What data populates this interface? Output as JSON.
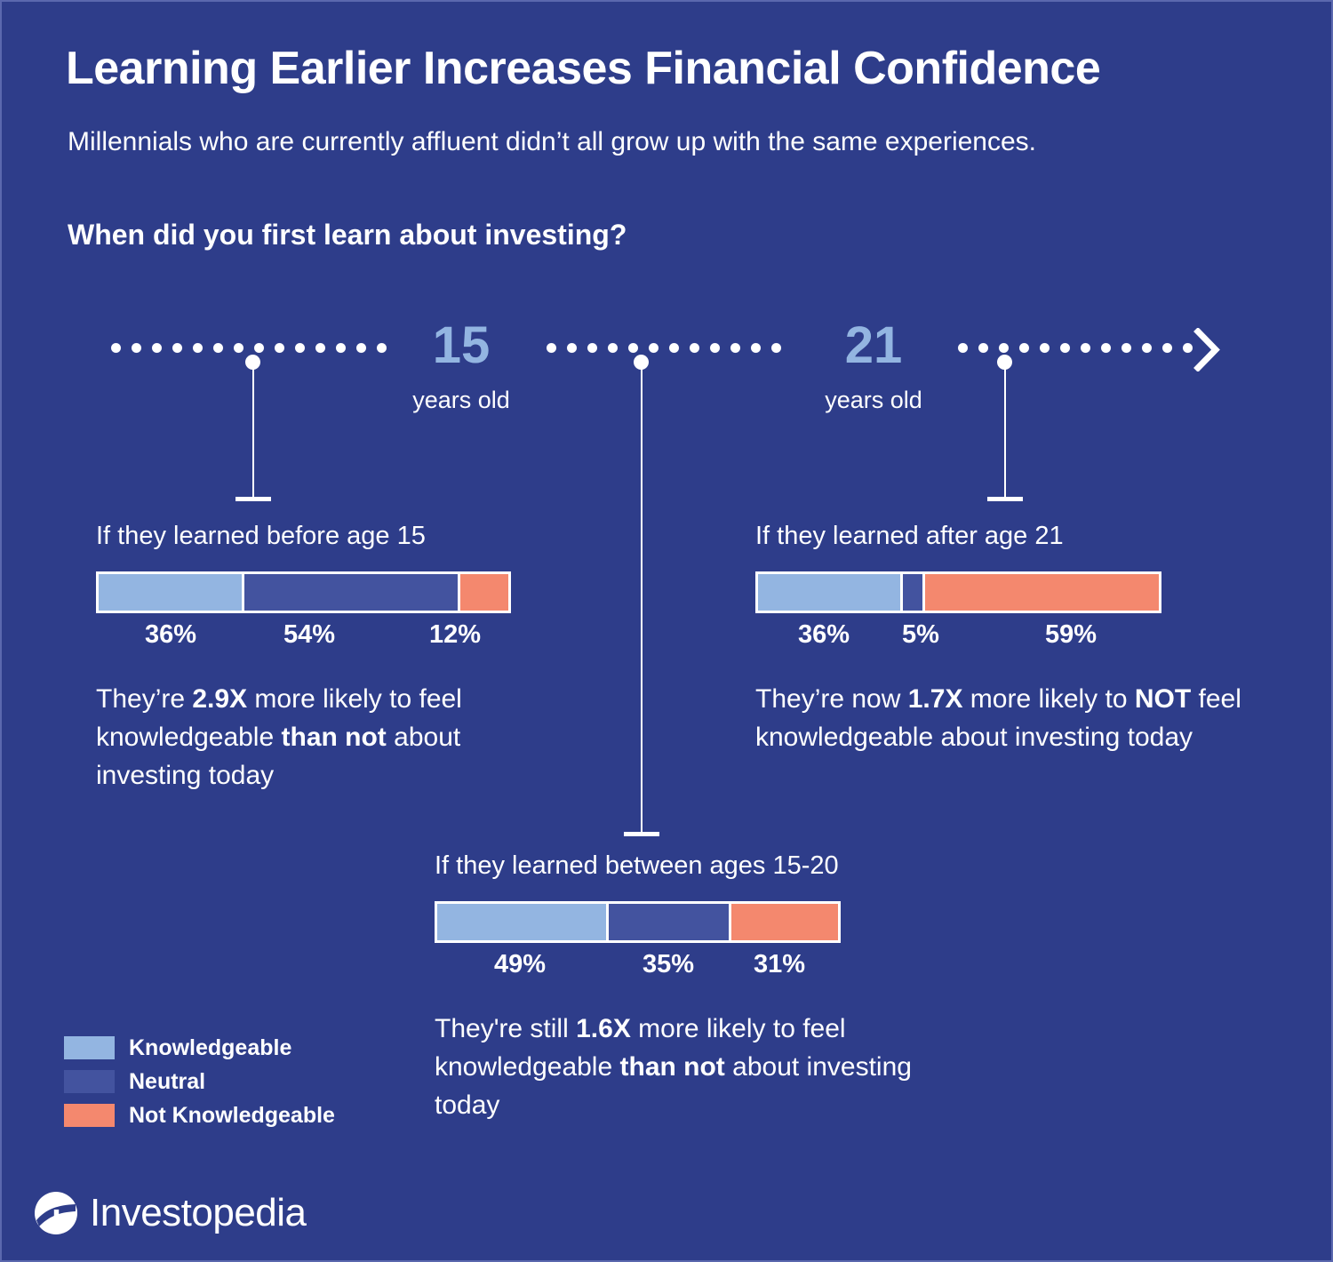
{
  "header": {
    "title": "Learning Earlier Increases Financial Confidence",
    "subtitle": "Millennials who are currently affluent didn’t all grow up with the same experiences.",
    "question": "When did you first learn about investing?"
  },
  "timeline": {
    "marker_1_number": "15",
    "marker_1_unit": "years old",
    "marker_2_number": "21",
    "marker_2_unit": "years old",
    "arrow_icon": "chevron-right-icon"
  },
  "legend": {
    "items": [
      {
        "label": "Knowledgeable",
        "color": "#93b5e1"
      },
      {
        "label": "Neutral",
        "color": "#43539f"
      },
      {
        "label": "Not Knowledgeable",
        "color": "#f4886e"
      }
    ]
  },
  "panels": {
    "left": {
      "label": "If they learned before age 15",
      "values": [
        "36%",
        "54%",
        "12%"
      ],
      "blurb_parts": [
        "They’re ",
        "2.9X",
        " more likely to feel knowledgeable ",
        "than not",
        " about investing today"
      ]
    },
    "middle": {
      "label": "If they learned between ages 15-20",
      "values": [
        "49%",
        "35%",
        "31%"
      ],
      "blurb_parts": [
        "They're still ",
        "1.6X",
        " more likely to feel knowledgeable ",
        "than not",
        " about investing today"
      ]
    },
    "right": {
      "label": "If they learned after age 21",
      "values": [
        "36%",
        "5%",
        "59%"
      ],
      "blurb_parts": [
        "They’re now ",
        "1.7X",
        " more likely to ",
        "NOT",
        " feel knowledgeable about investing today"
      ]
    }
  },
  "branding": {
    "name": "Investopedia",
    "logo_icon": "investopedia-logo-icon"
  },
  "colors": {
    "background": "#2e3d8a",
    "knowledgeable": "#93b5e1",
    "neutral": "#43539f",
    "not_knowledgeable": "#f4886e",
    "text": "#ffffff"
  },
  "chart_data": {
    "type": "bar",
    "title": "Learning Earlier Increases Financial Confidence",
    "subtitle": "Millennials who are currently affluent didn’t all grow up with the same experiences.",
    "question": "When did you first learn about investing?",
    "orientation": "horizontal-stacked",
    "categories": [
      "If they learned before age 15",
      "If they learned between ages 15-20",
      "If they learned after age 21"
    ],
    "series": [
      {
        "name": "Knowledgeable",
        "color": "#93b5e1",
        "values": [
          36,
          49,
          36
        ]
      },
      {
        "name": "Neutral",
        "color": "#43539f",
        "values": [
          54,
          35,
          5
        ]
      },
      {
        "name": "Not Knowledgeable",
        "color": "#f4886e",
        "values": [
          12,
          31,
          59
        ]
      }
    ],
    "value_labels": [
      [
        "36%",
        "54%",
        "12%"
      ],
      [
        "49%",
        "35%",
        "31%"
      ],
      [
        "36%",
        "5%",
        "59%"
      ]
    ],
    "annotations": [
      "They’re 2.9X more likely to feel knowledgeable than not about investing today",
      "They're still 1.6X more likely to feel knowledgeable than not about investing today",
      "They’re now 1.7X more likely to NOT feel knowledgeable about investing today"
    ],
    "timeline_markers": [
      "15 years old",
      "21 years old"
    ],
    "legend_position": "bottom-left",
    "grid": false,
    "xlabel": "",
    "ylabel": ""
  }
}
